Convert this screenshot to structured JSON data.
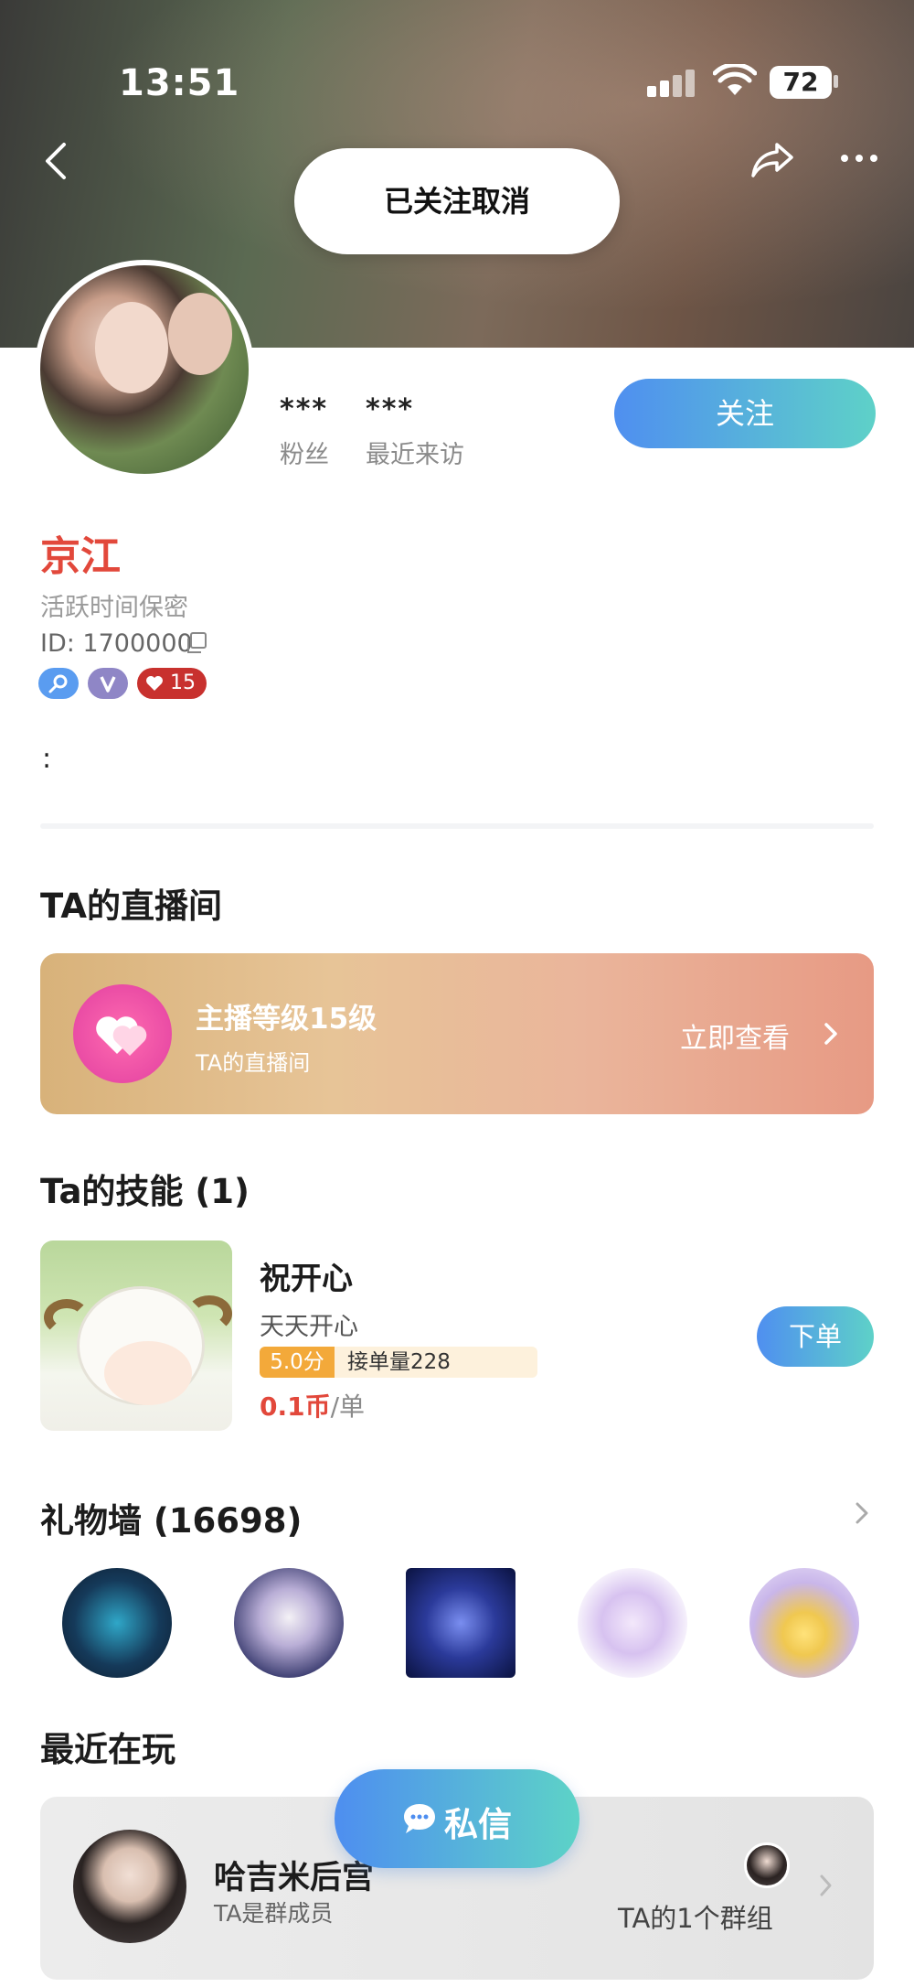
{
  "status_bar": {
    "time": "13:51",
    "battery": "72"
  },
  "toast": {
    "text": "已关注取消"
  },
  "profile": {
    "stats": [
      {
        "value": "***",
        "label": "粉丝"
      },
      {
        "value": "***",
        "label": "最近来访"
      }
    ],
    "follow_label": "关注",
    "name": "京江",
    "active_text": "活跃时间保密",
    "id_text": "ID: 1700000",
    "badges": [
      {
        "icon": "search-badge-icon",
        "text": "",
        "color": "#5a9cf0"
      },
      {
        "icon": "v-badge-icon",
        "text": "",
        "color": "#8f86c6"
      },
      {
        "icon": "heart-level-badge-icon",
        "text": "15",
        "color": "#c8312e"
      }
    ],
    "signature": ":"
  },
  "live": {
    "section_title": "TA的直播间",
    "title": "主播等级15级",
    "subtitle": "TA的直播间",
    "link_label": "立即查看"
  },
  "skills": {
    "section_title": "Ta的技能 (1)",
    "items": [
      {
        "name": "祝开心",
        "desc": "天天开心",
        "score": "5.0分",
        "orders": "接单量228",
        "price": "0.1币",
        "price_unit": "/单",
        "order_label": "下单"
      }
    ]
  },
  "gift_wall": {
    "section_title": "礼物墙 (16698)",
    "gifts": [
      "gift-icon",
      "gift-icon",
      "gift-icon",
      "gift-icon",
      "gift-icon"
    ]
  },
  "recent": {
    "section_title": "最近在玩",
    "group_name": "哈吉米后宫",
    "group_role": "TA是群成员",
    "group_count": "TA的1个群组"
  },
  "dm_button": {
    "label": "私信"
  },
  "colors": {
    "accent_start": "#4f8ff0",
    "accent_end": "#5ed1c8",
    "name_red": "#e2483b"
  }
}
